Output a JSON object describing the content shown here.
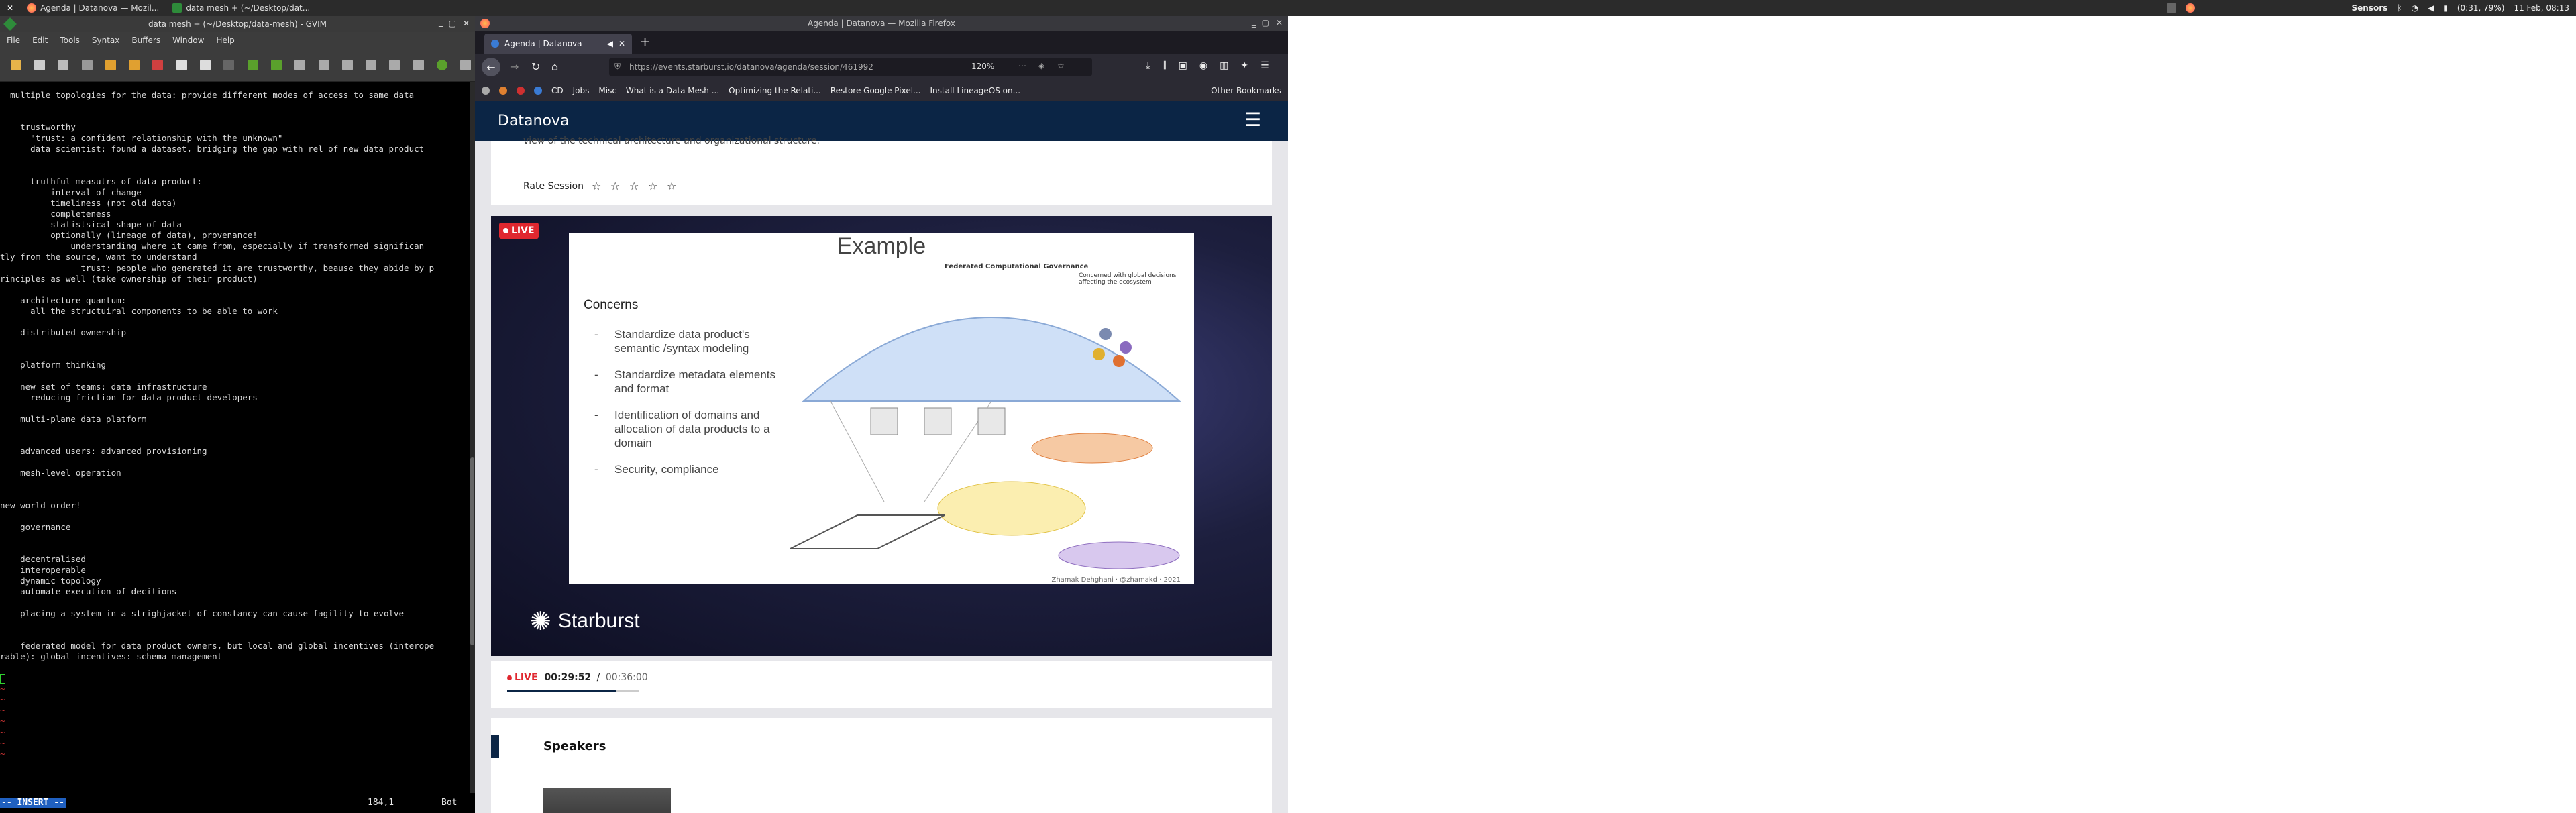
{
  "system_panel": {
    "tasks": [
      {
        "label": "Agenda | Datanova — Mozil...",
        "icon": "firefox-icon"
      },
      {
        "label": "data mesh + (~/Desktop/dat...",
        "icon": "gvim-icon"
      }
    ],
    "sensors_label": "Sensors",
    "battery": "(0:31, 79%)",
    "clock": "11 Feb, 08:13"
  },
  "gvim": {
    "title": "data mesh + (~/Desktop/data-mesh) - GVIM",
    "menu": [
      "File",
      "Edit",
      "Tools",
      "Syntax",
      "Buffers",
      "Window",
      "Help"
    ],
    "lines": [
      "  multiple topologies for the data: provide different modes of access to same data",
      "",
      "",
      "    trustworthy",
      "      \"trust: a confident relationship with the unknown\"",
      "      data scientist: found a dataset, bridging the gap with rel of new data product",
      "",
      "",
      "      truthful measutrs of data product:",
      "          interval of change",
      "          timeliness (not old data)",
      "          completeness",
      "          statistsical shape of data",
      "          optionally (lineage of data), provenance!",
      "              understanding where it came from, especially if transformed significan",
      "tly from the source, want to understand",
      "                trust: people who generated it are trustworthy, beause they abide by p",
      "rinciples as well (take ownership of their product)",
      "",
      "    architecture quantum:",
      "      all the structuiral components to be able to work",
      "",
      "    distributed ownership",
      "",
      "",
      "    platform thinking",
      "",
      "    new set of teams: data infrastructure",
      "      reducing friction for data product developers",
      "",
      "    multi-plane data platform",
      "",
      "",
      "    advanced users: advanced provisioning",
      "",
      "    mesh-level operation",
      "",
      "",
      "new world order!",
      "",
      "    governance",
      "",
      "",
      "    decentralised",
      "    interoperable",
      "    dynamic topology",
      "    automate execution of decitions",
      "",
      "    placing a system in a strighjacket of constancy can cause fagility to evolve",
      "",
      "",
      "    federated model for data product owners, but local and global incentives (interope",
      "rable): global incentives: schema management",
      "",
      "",
      "~",
      "~",
      "~",
      "~",
      "~",
      "~",
      "~"
    ],
    "status_mode": "-- INSERT --",
    "status_pos": "184,1",
    "status_scroll": "Bot"
  },
  "firefox": {
    "title": "Agenda | Datanova — Mozilla Firefox",
    "tab_label": "Agenda | Datanova",
    "url": "https://events.starburst.io/datanova/agenda/session/461992",
    "zoom": "120%",
    "bookmarks": [
      "CD",
      "Jobs",
      "Misc",
      "What is a Data Mesh ...",
      "Optimizing the Relati...",
      "Restore Google Pixel...",
      "Install LineageOS on..."
    ],
    "other_bookmarks": "Other Bookmarks"
  },
  "page": {
    "site_name": "Datanova",
    "truncated_text": "view of the technical architecture and organizational structure.",
    "rate_label": "Rate Session",
    "live_badge": "LIVE",
    "slide": {
      "title": "Example",
      "section": "Concerns",
      "bullets": [
        "Standardize data product's semantic /syntax modeling",
        "Standardize metadata elements and format",
        "Identification of domains and allocation of data products to a domain",
        "Security, compliance"
      ],
      "diagram_title": "Federated Computational Governance",
      "diagram_note": "Concerned with global decisions affecting the ecosystem",
      "footer": "Zhamak Dehghani · @zhamakd · 2021"
    },
    "video_brand": "Starburst",
    "player_live": "LIVE",
    "player_time": "00:29:52",
    "player_sep": " / ",
    "player_total": "00:36:00",
    "progress": 0.83,
    "speakers_heading": "Speakers"
  },
  "colors": {
    "accent": "#0b2545",
    "live": "#e0272f"
  }
}
